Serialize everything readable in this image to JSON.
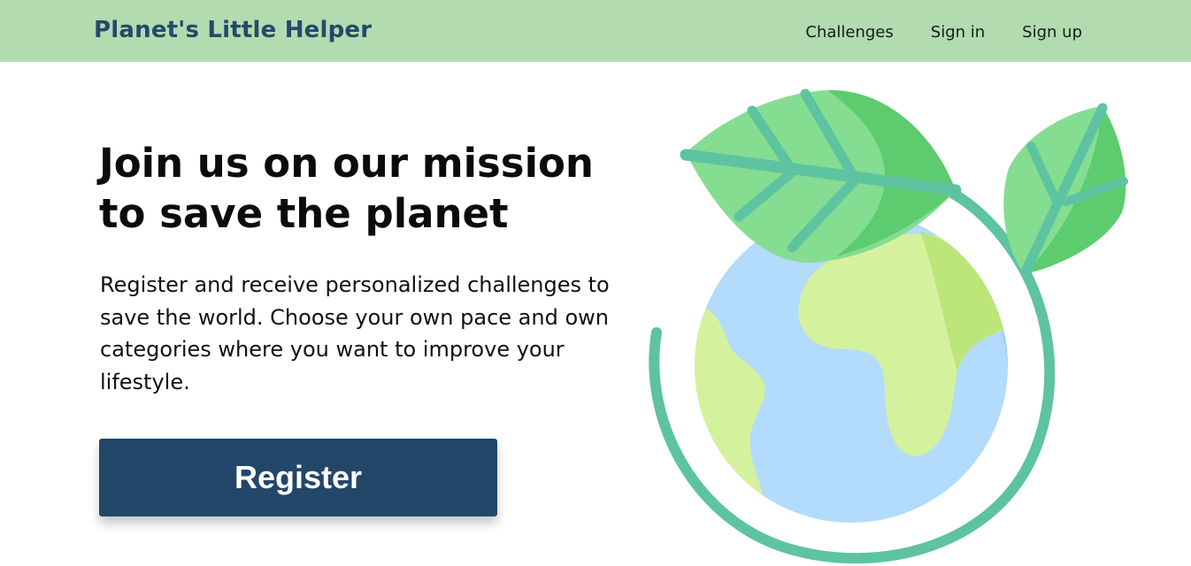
{
  "navbar": {
    "brand": "Planet's Little Helper",
    "links": [
      {
        "label": "Challenges"
      },
      {
        "label": "Sign in"
      },
      {
        "label": "Sign up"
      }
    ]
  },
  "hero": {
    "title": "Join us on our mission to save the planet",
    "description": "Register and receive personalized challenges to save the world. Choose your own pace and own categories where you want to improve your lifestyle.",
    "cta_label": "Register"
  },
  "illustration": {
    "icon": "earth-with-leaves-icon"
  },
  "colors": {
    "navbar_bg": "#b2dbb0",
    "brand_text": "#234a69",
    "button_bg": "#224769",
    "button_text": "#ffffff",
    "ocean": "#b3dbfc",
    "land": "#d4f29d",
    "leaf": "#85dd92",
    "vein": "#5dc3a1"
  }
}
